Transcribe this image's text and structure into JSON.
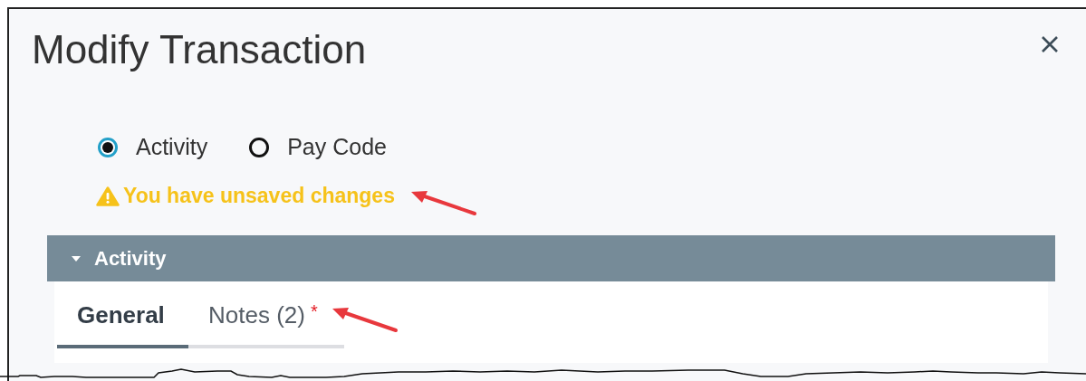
{
  "dialog": {
    "title": "Modify Transaction"
  },
  "type_options": [
    {
      "label": "Activity",
      "selected": true
    },
    {
      "label": "Pay Code",
      "selected": false
    }
  ],
  "warning": {
    "text": "You have unsaved changes"
  },
  "section": {
    "label": "Activity",
    "expanded": true
  },
  "tabs": [
    {
      "label": "General",
      "selected": true
    },
    {
      "label": "Notes (2)",
      "selected": false,
      "marker": "*"
    }
  ]
}
